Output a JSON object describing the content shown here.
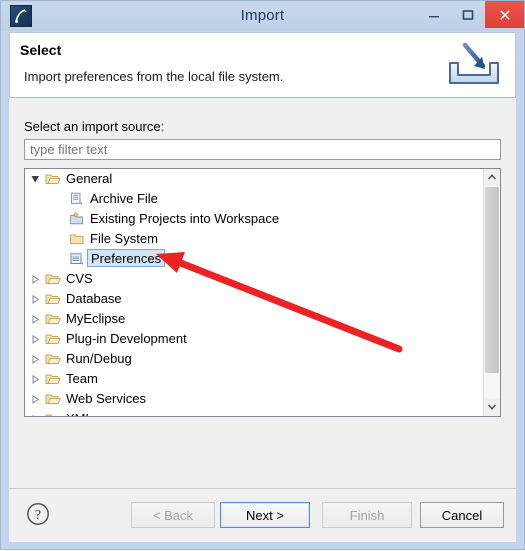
{
  "window": {
    "title": "Import",
    "app_icon": "myeclipse-icon",
    "controls": {
      "minimize": "minimize-icon",
      "maximize": "maximize-icon",
      "close": "close-icon",
      "close_color": "#e04136"
    }
  },
  "header": {
    "title": "Select",
    "description": "Import preferences from the local file system.",
    "icon": "import-wizard-icon"
  },
  "main": {
    "source_label": "Select an import source:",
    "filter": {
      "value": "",
      "placeholder": "type filter text"
    },
    "tree": {
      "selected": "Preferences",
      "nodes": [
        {
          "label": "General",
          "depth": 0,
          "state": "expanded",
          "icon": "folder-open-icon"
        },
        {
          "label": "Archive File",
          "depth": 1,
          "state": "leaf",
          "icon": "archive-file-icon"
        },
        {
          "label": "Existing Projects into Workspace",
          "depth": 1,
          "state": "leaf",
          "icon": "existing-projects-icon"
        },
        {
          "label": "File System",
          "depth": 1,
          "state": "leaf",
          "icon": "file-system-icon"
        },
        {
          "label": "Preferences",
          "depth": 1,
          "state": "leaf",
          "icon": "preferences-icon"
        },
        {
          "label": "CVS",
          "depth": 0,
          "state": "collapsed",
          "icon": "folder-open-icon"
        },
        {
          "label": "Database",
          "depth": 0,
          "state": "collapsed",
          "icon": "folder-open-icon"
        },
        {
          "label": "MyEclipse",
          "depth": 0,
          "state": "collapsed",
          "icon": "folder-open-icon"
        },
        {
          "label": "Plug-in Development",
          "depth": 0,
          "state": "collapsed",
          "icon": "folder-open-icon"
        },
        {
          "label": "Run/Debug",
          "depth": 0,
          "state": "collapsed",
          "icon": "folder-open-icon"
        },
        {
          "label": "Team",
          "depth": 0,
          "state": "collapsed",
          "icon": "folder-open-icon"
        },
        {
          "label": "Web Services",
          "depth": 0,
          "state": "collapsed",
          "icon": "folder-open-icon"
        },
        {
          "label": "XML",
          "depth": 0,
          "state": "collapsed",
          "icon": "folder-open-icon"
        }
      ]
    },
    "scrollbar": {
      "up": "scroll-up-icon",
      "down": "scroll-down-icon"
    }
  },
  "footer": {
    "help": "help-icon",
    "buttons": {
      "back": {
        "label": "< Back",
        "enabled": false,
        "focused": false
      },
      "next": {
        "label": "Next >",
        "enabled": true,
        "focused": true
      },
      "finish": {
        "label": "Finish",
        "enabled": false,
        "focused": false
      },
      "cancel": {
        "label": "Cancel",
        "enabled": true,
        "focused": false
      }
    }
  },
  "annotation": {
    "type": "arrow",
    "color": "#ee2222",
    "points_to": "Preferences"
  }
}
